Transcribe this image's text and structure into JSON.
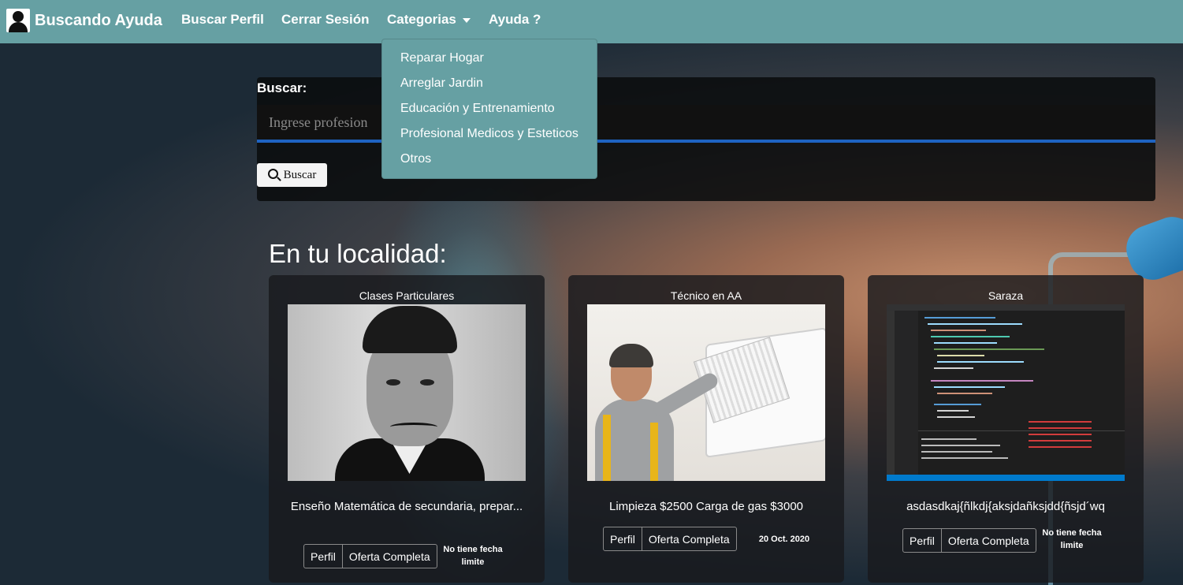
{
  "navbar": {
    "brand": "Buscando Ayuda",
    "items": {
      "buscar_perfil": "Buscar Perfil",
      "cerrar_sesion": "Cerrar Sesión",
      "categorias": "Categorias",
      "ayuda": "Ayuda ?"
    },
    "bg_color": "#66a0a3"
  },
  "dropdown": {
    "items": [
      "Reparar Hogar",
      "Arreglar Jardin",
      "Educación y Entrenamiento",
      "Profesional Medicos y Esteticos",
      "Otros"
    ]
  },
  "search": {
    "label": "Buscar:",
    "placeholder": "Ingrese profesion",
    "button": "Buscar",
    "accent": "#1e63c2"
  },
  "section_title": "En tu localidad:",
  "cards": [
    {
      "title": "Clases Particulares",
      "description": "Enseño Matemática de secundaria, prepar...",
      "buttons": [
        "Perfil",
        "Oferta Completa"
      ],
      "date": "No tiene fecha limite"
    },
    {
      "title": "Técnico en AA",
      "description": "Limpieza $2500 Carga de gas $3000",
      "buttons": [
        "Perfil",
        "Oferta Completa"
      ],
      "date": "20 Oct. 2020"
    },
    {
      "title": "Saraza",
      "description": "asdasdkaj{ñlkdj{aksjdañksjdd{ñsjd´wq",
      "buttons": [
        "Perfil",
        "Oferta Completa"
      ],
      "date": "No tiene fecha limite"
    }
  ]
}
